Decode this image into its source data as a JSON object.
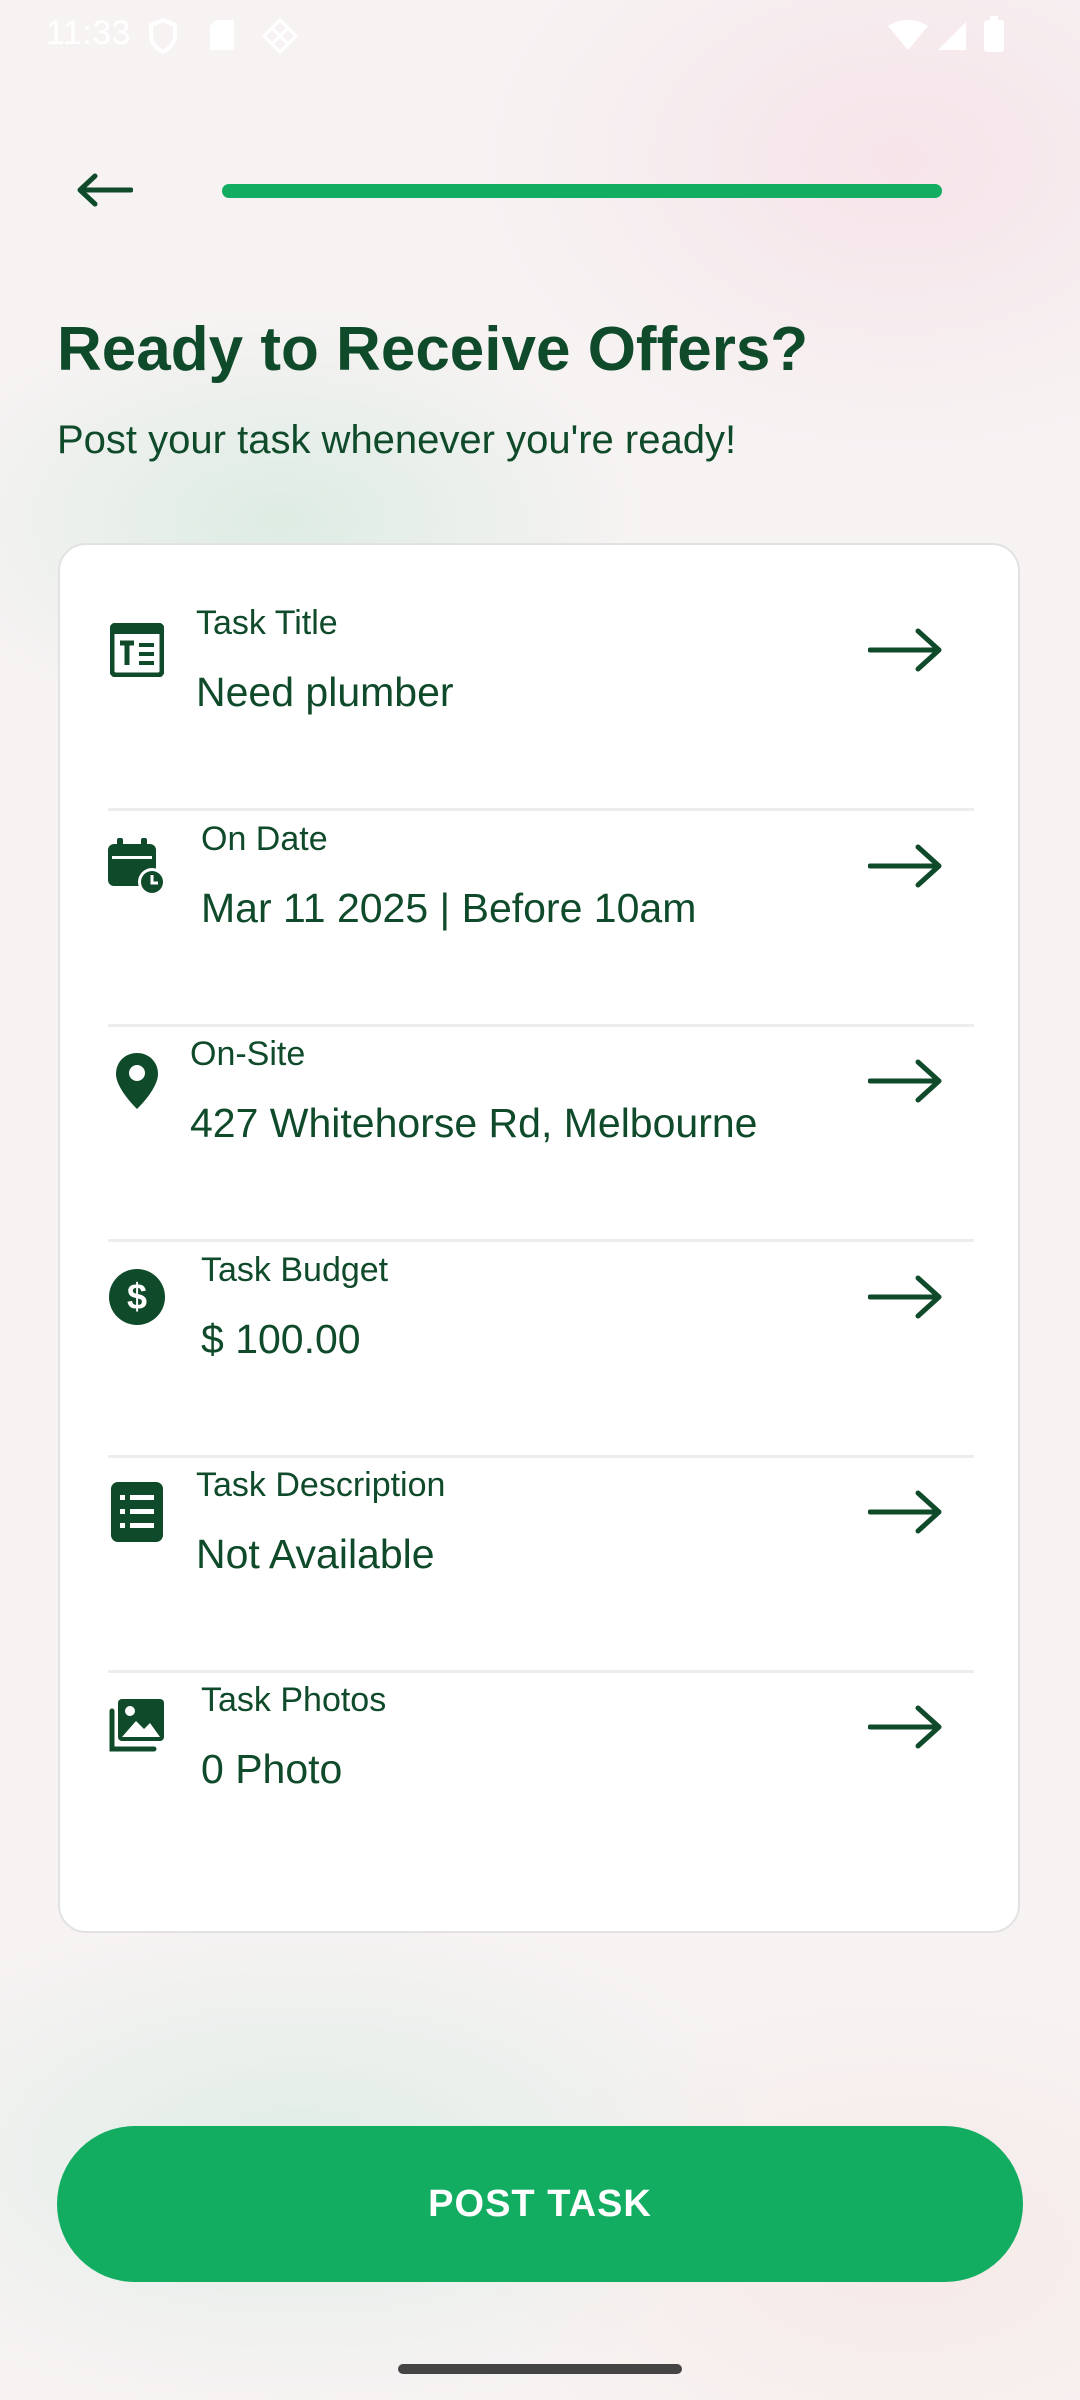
{
  "status_bar": {
    "time": "11:33",
    "left_icons": [
      "shield-icon",
      "sd-card-icon",
      "diamond-pattern-icon"
    ],
    "right_icons": [
      "wifi-icon",
      "signal-icon",
      "battery-icon"
    ]
  },
  "header": {
    "back_icon": "arrow-left-icon",
    "progress": 1.0,
    "progress_color": "#13ad62"
  },
  "title": "Ready to Receive Offers?",
  "subtitle": "Post your task whenever you're ready!",
  "summary_items": [
    {
      "icon": "title-text-icon",
      "label": "Task Title",
      "value": "Need plumber"
    },
    {
      "icon": "calendar-clock-icon",
      "label": "On Date",
      "value": "Mar 11 2025 | Before 10am"
    },
    {
      "icon": "location-pin-icon",
      "label": "On-Site",
      "value": "427 Whitehorse Rd, Melbourne"
    },
    {
      "icon": "dollar-circle-icon",
      "label": "Task Budget",
      "value": "$ 100.00"
    },
    {
      "icon": "description-list-icon",
      "label": "Task Description",
      "value": "Not Available"
    },
    {
      "icon": "photos-icon",
      "label": "Task Photos",
      "value": "0 Photo"
    }
  ],
  "post_button": {
    "label": "POST TASK",
    "color": "#13ad62"
  },
  "colors": {
    "text": "#0f4a2a",
    "accent": "#13ad62"
  }
}
